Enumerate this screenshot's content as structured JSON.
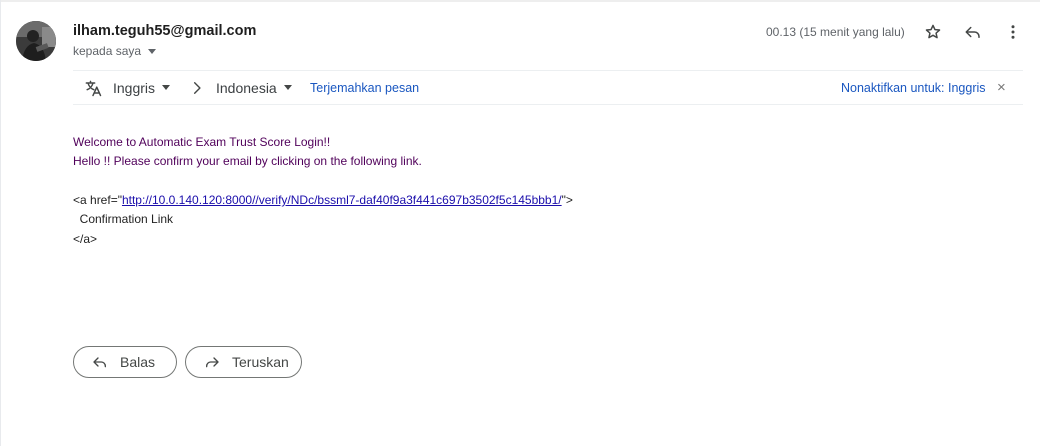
{
  "header": {
    "sender": "ilham.teguh55@gmail.com",
    "recipient_label": "kepada saya",
    "timestamp": "00.13 (15 menit yang lalu)",
    "icons": [
      "star-icon",
      "reply-icon",
      "more-vert-icon"
    ]
  },
  "translate_bar": {
    "source_language": "Inggris",
    "target_language": "Indonesia",
    "translate_link": "Terjemahkan pesan",
    "disable_link": "Nonaktifkan untuk: Inggris",
    "close_glyph": "×",
    "icons": [
      "translate-icon",
      "chevron-right-icon",
      "close-icon"
    ]
  },
  "message": {
    "line1": "Welcome to Automatic Exam Trust Score Login!!",
    "line2": "Hello !! Please confirm your email by clicking on the following link.",
    "anchor_open_prefix": "<a href=\"",
    "url": "http://10.0.140.120:8000//verify/NDc/bssml7-daf40f9a3f441c697b3502f5c145bbb1/",
    "anchor_open_suffix": "\">",
    "link_text": "  Confirmation Link",
    "anchor_close": "</a>"
  },
  "actions": {
    "reply_label": "Balas",
    "forward_label": "Teruskan",
    "icons": [
      "reply-arrow-icon",
      "forward-arrow-icon"
    ]
  },
  "colors": {
    "purple_text": "#50005a",
    "link_blue": "#1a57c0",
    "url_blue": "#1a0dab",
    "muted_gray": "#5f6368"
  }
}
